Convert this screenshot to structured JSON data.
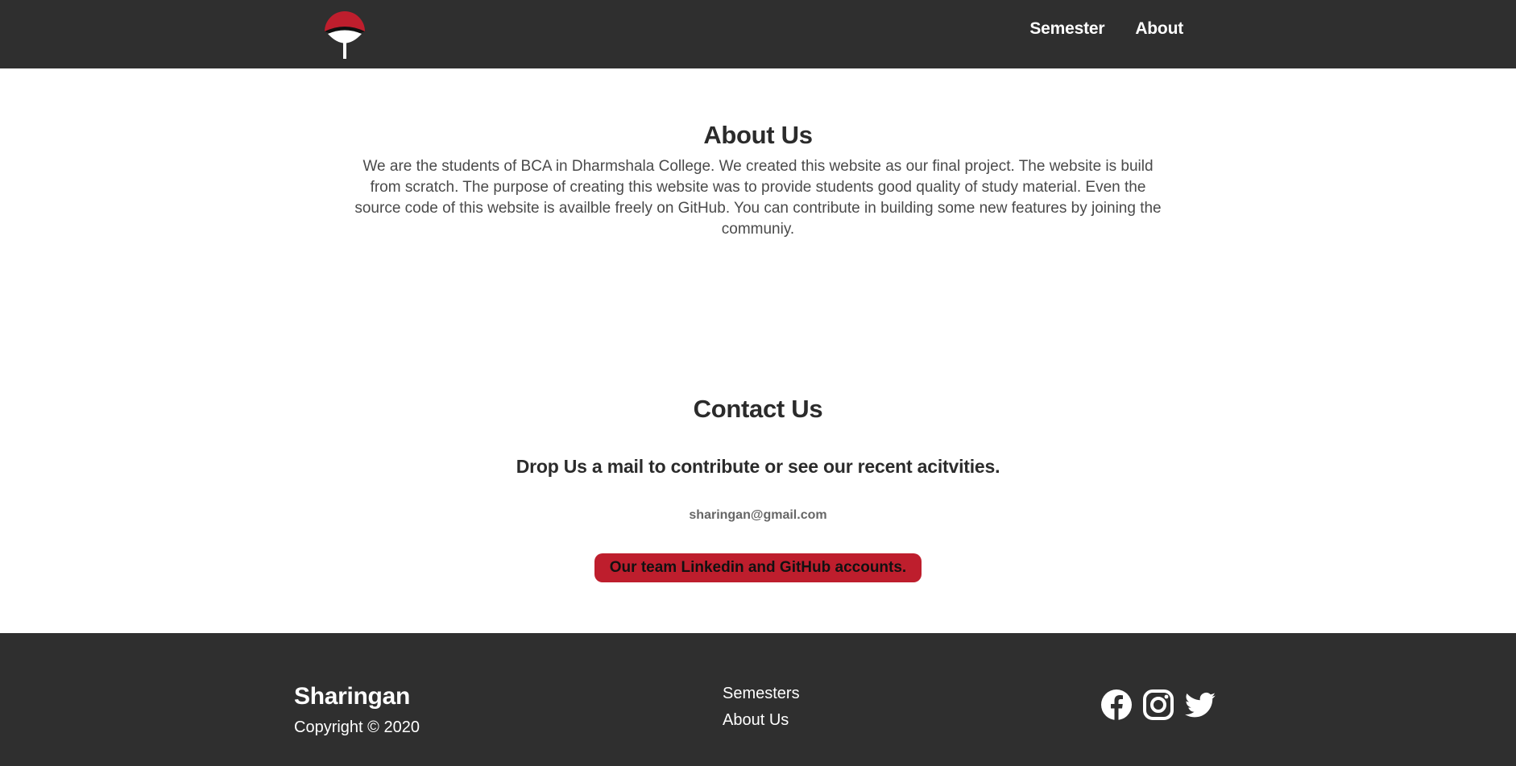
{
  "header": {
    "nav": [
      {
        "label": "Semester"
      },
      {
        "label": "About"
      }
    ]
  },
  "about": {
    "title": "About Us",
    "body": "We are the students of BCA in Dharmshala College. We created this website as our final project. The website is build from scratch. The purpose of creating this website was to provide students good quality of study material. Even the source code of this website is availble freely on GitHub. You can contribute in building some new features by joining the communiy."
  },
  "contact": {
    "title": "Contact Us",
    "subtitle": "Drop Us a mail to contribute or see our recent acitvities.",
    "email": "sharingan@gmail.com",
    "team_button": "Our team Linkedin and GitHub accounts."
  },
  "footer": {
    "brand": "Sharingan",
    "copyright": "Copyright © 2020",
    "links": [
      {
        "label": "Semesters"
      },
      {
        "label": "About Us"
      }
    ],
    "social_icons": [
      "facebook-icon",
      "instagram-icon",
      "twitter-icon"
    ]
  },
  "colors": {
    "header_bg": "#2f2f2f",
    "accent": "#be1e2d",
    "text": "#2b2b2b"
  }
}
